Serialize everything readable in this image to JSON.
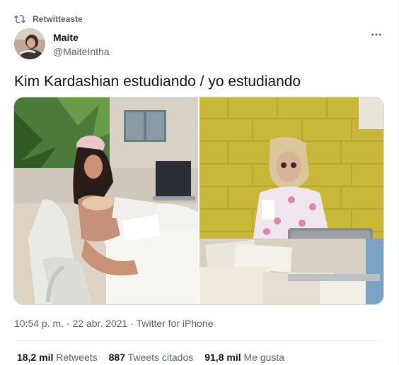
{
  "social_context": {
    "label": "Retwitteaste",
    "icon": "retweet-icon"
  },
  "author": {
    "name": "Maite",
    "handle": "@MaiteIntha"
  },
  "more_icon": "more-horizontal-icon",
  "tweet": {
    "text": "Kim Kardashian estudiando / yo estudiando"
  },
  "meta": {
    "time": "10:54 p. m.",
    "separator": "·",
    "date": "22 abr. 2021",
    "source": "Twitter for iPhone"
  },
  "stats": {
    "retweets_count": "18,2 mil",
    "retweets_label": "Retweets",
    "quotes_count": "887",
    "quotes_label": "Tweets citados",
    "likes_count": "91,8 mil",
    "likes_label": "Me gusta"
  },
  "colors": {
    "text_primary": "#0f1419",
    "text_secondary": "#536471",
    "border": "#cfd9de",
    "divider": "#eff3f4"
  }
}
